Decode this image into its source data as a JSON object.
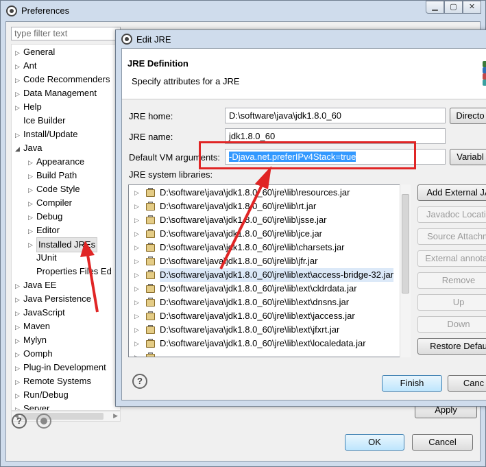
{
  "preferences": {
    "title": "Preferences",
    "filter_placeholder": "type filter text",
    "tree": [
      {
        "label": "General",
        "level": 0,
        "arrow": "▷"
      },
      {
        "label": "Ant",
        "level": 0,
        "arrow": "▷"
      },
      {
        "label": "Code Recommenders",
        "level": 0,
        "arrow": "▷"
      },
      {
        "label": "Data Management",
        "level": 0,
        "arrow": "▷"
      },
      {
        "label": "Help",
        "level": 0,
        "arrow": "▷"
      },
      {
        "label": "Ice Builder",
        "level": 0,
        "arrow": ""
      },
      {
        "label": "Install/Update",
        "level": 0,
        "arrow": "▷"
      },
      {
        "label": "Java",
        "level": 0,
        "arrow": "◢"
      },
      {
        "label": "Appearance",
        "level": 1,
        "arrow": "▷"
      },
      {
        "label": "Build Path",
        "level": 1,
        "arrow": "▷"
      },
      {
        "label": "Code Style",
        "level": 1,
        "arrow": "▷"
      },
      {
        "label": "Compiler",
        "level": 1,
        "arrow": "▷"
      },
      {
        "label": "Debug",
        "level": 1,
        "arrow": "▷"
      },
      {
        "label": "Editor",
        "level": 1,
        "arrow": "▷"
      },
      {
        "label": "Installed JREs",
        "level": 1,
        "arrow": "▷",
        "selected": true
      },
      {
        "label": "JUnit",
        "level": 1,
        "arrow": ""
      },
      {
        "label": "Properties Files Ed",
        "level": 1,
        "arrow": ""
      },
      {
        "label": "Java EE",
        "level": 0,
        "arrow": "▷"
      },
      {
        "label": "Java Persistence",
        "level": 0,
        "arrow": "▷"
      },
      {
        "label": "JavaScript",
        "level": 0,
        "arrow": "▷"
      },
      {
        "label": "Maven",
        "level": 0,
        "arrow": "▷"
      },
      {
        "label": "Mylyn",
        "level": 0,
        "arrow": "▷"
      },
      {
        "label": "Oomph",
        "level": 0,
        "arrow": "▷"
      },
      {
        "label": "Plug-in Development",
        "level": 0,
        "arrow": "▷"
      },
      {
        "label": "Remote Systems",
        "level": 0,
        "arrow": "▷"
      },
      {
        "label": "Run/Debug",
        "level": 0,
        "arrow": "▷"
      },
      {
        "label": "Server",
        "level": 0,
        "arrow": "▷"
      }
    ],
    "apply_label": "Apply",
    "ok_label": "OK",
    "cancel_label": "Cancel"
  },
  "edit_jre": {
    "title": "Edit JRE",
    "header_title": "JRE Definition",
    "header_message": "Specify attributes for a JRE",
    "jre_home_label": "JRE home:",
    "jre_home_value": "D:\\software\\java\\jdk1.8.0_60",
    "directory_label": "Directo",
    "jre_name_label": "JRE name:",
    "jre_name_value": "jdk1.8.0_60",
    "vm_args_label": "Default VM arguments:",
    "vm_args_value": "-Djava.net.preferIPv4Stack=true",
    "variables_label": "Variabl",
    "libraries_label": "JRE system libraries:",
    "libraries": [
      "D:\\software\\java\\jdk1.8.0_60\\jre\\lib\\resources.jar",
      "D:\\software\\java\\jdk1.8.0_60\\jre\\lib\\rt.jar",
      "D:\\software\\java\\jdk1.8.0_60\\jre\\lib\\jsse.jar",
      "D:\\software\\java\\jdk1.8.0_60\\jre\\lib\\jce.jar",
      "D:\\software\\java\\jdk1.8.0_60\\jre\\lib\\charsets.jar",
      "D:\\software\\java\\jdk1.8.0_60\\jre\\lib\\jfr.jar",
      "D:\\software\\java\\jdk1.8.0_60\\jre\\lib\\ext\\access-bridge-32.jar",
      "D:\\software\\java\\jdk1.8.0_60\\jre\\lib\\ext\\cldrdata.jar",
      "D:\\software\\java\\jdk1.8.0_60\\jre\\lib\\ext\\dnsns.jar",
      "D:\\software\\java\\jdk1.8.0_60\\jre\\lib\\ext\\jaccess.jar",
      "D:\\software\\java\\jdk1.8.0_60\\jre\\lib\\ext\\jfxrt.jar",
      "D:\\software\\java\\jdk1.8.0_60\\jre\\lib\\ext\\localedata.jar"
    ],
    "side_buttons": [
      {
        "label": "Add External JA",
        "enabled": true
      },
      {
        "label": "Javadoc Locatio",
        "enabled": false
      },
      {
        "label": "Source Attachm",
        "enabled": false
      },
      {
        "label": "External annotati",
        "enabled": false
      },
      {
        "label": "Remove",
        "enabled": false
      },
      {
        "label": "Up",
        "enabled": false
      },
      {
        "label": "Down",
        "enabled": false
      },
      {
        "label": "Restore Defau",
        "enabled": true
      }
    ],
    "finish_label": "Finish",
    "cancel_label": "Canc"
  },
  "colors": {
    "annotation_red": "#e02525",
    "selection_blue": "#3399ff"
  }
}
